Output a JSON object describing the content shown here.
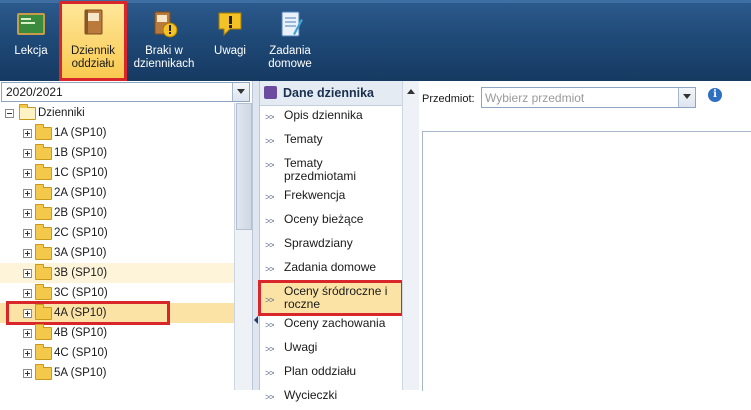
{
  "toolbar": {
    "buttons": [
      {
        "label": "Lekcja",
        "icon": "lesson-board-icon"
      },
      {
        "label": "Dziennik\noddziału",
        "icon": "class-register-book-icon"
      },
      {
        "label": "Braki w\ndziennikach",
        "icon": "missing-entries-icon"
      },
      {
        "label": "Uwagi",
        "icon": "remarks-warning-icon"
      },
      {
        "label": "Zadania\ndomowe",
        "icon": "homework-notebook-icon"
      }
    ]
  },
  "left_panel": {
    "year_select": "2020/2021",
    "root": "Dzienniki",
    "classes": [
      "1A (SP10)",
      "1B (SP10)",
      "1C (SP10)",
      "2A (SP10)",
      "2B (SP10)",
      "2C (SP10)",
      "3A (SP10)",
      "3B (SP10)",
      "3C (SP10)",
      "4A (SP10)",
      "4B (SP10)",
      "4C (SP10)",
      "5A (SP10)"
    ]
  },
  "middle_panel": {
    "title": "Dane dziennika",
    "items": [
      "Opis dziennika",
      "Tematy",
      "Tematy przedmiotami",
      "Frekwencja",
      "Oceny bieżące",
      "Sprawdziany",
      "Zadania domowe",
      "Oceny śródroczne i roczne",
      "Oceny zachowania",
      "Uwagi",
      "Plan oddziału",
      "Wycieczki"
    ]
  },
  "right_panel": {
    "subject_label": "Przedmiot:",
    "subject_placeholder": "Wybierz przedmiot"
  },
  "colors": {
    "toolbar": "#1f4a78",
    "active_yellow": "#fbe3a6",
    "highlight_red": "#d9262b"
  }
}
